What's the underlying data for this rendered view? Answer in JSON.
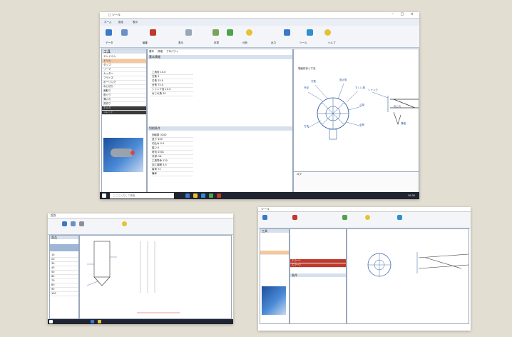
{
  "colors": {
    "background": "#e2ded2",
    "ribbon": "#f3f5f9",
    "taskbar": "#1f2430",
    "selection": "#f6c79a",
    "diagram_line": "#2c5aa0",
    "error_row": "#c0392b",
    "accent": "#3a78c9"
  },
  "main_window": {
    "title": "□ ツール",
    "tabs": [
      "ホーム",
      "設定",
      "表示"
    ],
    "ribbon_groups": [
      "データ",
      "編集",
      "表示",
      "計算",
      "分析",
      "出力",
      "ツール",
      "ヘルプ"
    ],
    "tree_title": "工具",
    "tree_items": [
      "エンドミル",
      "ドリル",
      "タップ",
      "リーマ",
      "カッター",
      "フライス",
      "ボーリング",
      "ねじ切り",
      "面取り",
      "座ぐり",
      "溝入れ",
      "突切り",
      "ホルダ",
      "コレット"
    ],
    "panel_tabs": [
      "基本",
      "詳細",
      "プロパティ"
    ],
    "grid1_title": "基本情報",
    "grid1_rows": [
      [
        "工具径",
        "10.0"
      ],
      [
        "刃数",
        "4"
      ],
      [
        "刃長",
        "25.0"
      ],
      [
        "全長",
        "75.0"
      ],
      [
        "シャンク径",
        "10.0"
      ],
      [
        "ねじれ角",
        "30"
      ]
    ],
    "grid2_title": "切削条件",
    "grid2_rows": [
      [
        "回転数",
        "3200"
      ],
      [
        "送り",
        "640"
      ],
      [
        "切込み",
        "5.0"
      ],
      [
        "幅",
        "2.0"
      ],
      [
        "材質",
        "S50C"
      ],
      [
        "冷却",
        "ON"
      ],
      [
        "工具寿命",
        "120"
      ],
      [
        "加工時間",
        "3.5"
      ],
      [
        "負荷",
        "72"
      ],
      [
        "備考",
        "-"
      ]
    ],
    "diagram_title": "端面形状と寸法",
    "callouts": [
      "外径",
      "刃数",
      "逃げ角",
      "すくい角",
      "心厚",
      "刃長",
      "全長",
      "シャンク",
      "ねじれ",
      "溝幅"
    ],
    "log_title": "ログ",
    "search_placeholder": "ここに入力して検索",
    "clock": "10:30"
  },
  "bottom_left_window": {
    "title": "設計",
    "list_title": "部品",
    "numbers": [
      "10",
      "20",
      "30",
      "40",
      "50",
      "60",
      "70",
      "80",
      "90",
      "100"
    ]
  },
  "bottom_right_window": {
    "title": "ツール",
    "tree_title": "工具",
    "error_rows": [
      "エラー1",
      "エラー2"
    ],
    "grid_title": "条件"
  }
}
